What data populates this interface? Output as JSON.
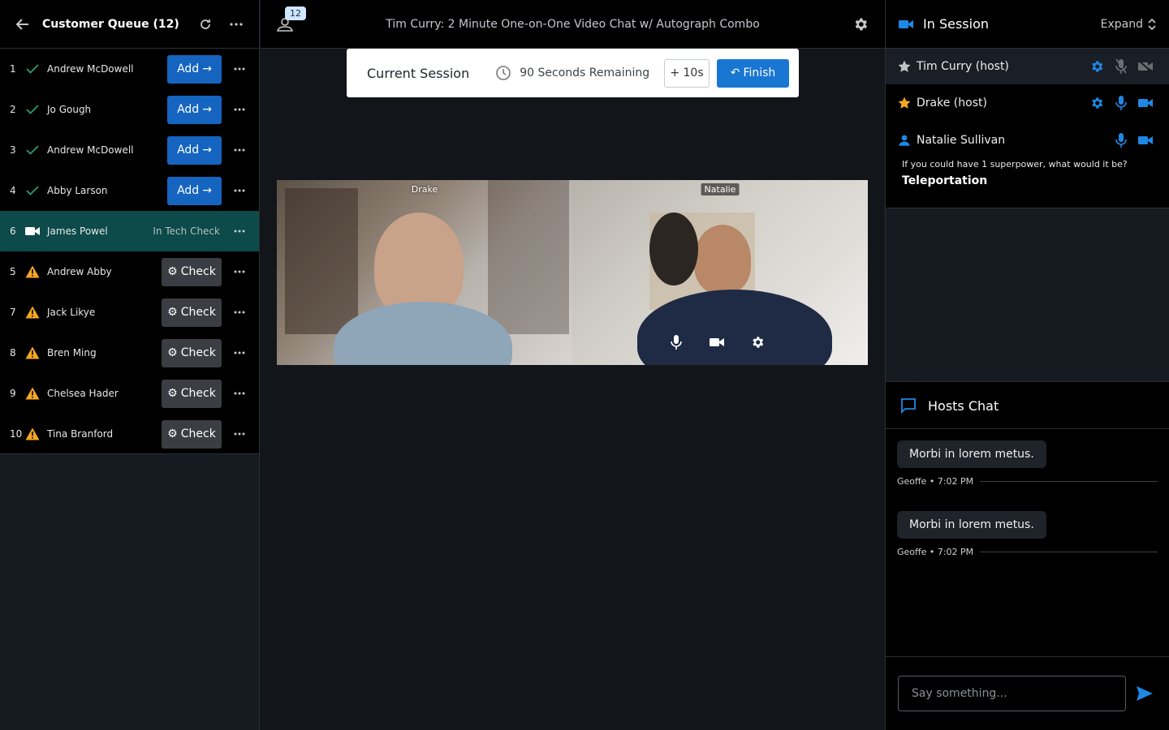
{
  "queue": {
    "title": "Customer Queue (12)",
    "rows": [
      {
        "num": "1",
        "name": "Andrew McDowell",
        "status": "ready",
        "action": "Add"
      },
      {
        "num": "2",
        "name": "Jo Gough",
        "status": "ready",
        "action": "Add"
      },
      {
        "num": "3",
        "name": "Andrew McDowell",
        "status": "ready",
        "action": "Add"
      },
      {
        "num": "4",
        "name": "Abby Larson",
        "status": "ready",
        "action": "Add"
      },
      {
        "num": "6",
        "name": "James Powel",
        "status": "in-tech-check",
        "state_text": "In Tech Check"
      },
      {
        "num": "5",
        "name": "Andrew Abby",
        "status": "warning",
        "action": "Check"
      },
      {
        "num": "7",
        "name": "Jack Likye",
        "status": "warning",
        "action": "Check"
      },
      {
        "num": "8",
        "name": "Bren Ming",
        "status": "warning",
        "action": "Check"
      },
      {
        "num": "9",
        "name": "Chelsea Hader",
        "status": "warning",
        "action": "Check"
      },
      {
        "num": "10",
        "name": "Tina Branford",
        "status": "warning",
        "action": "Check"
      }
    ]
  },
  "topbar": {
    "participant_count": "12",
    "event_title": "Tim Curry: 2 Minute One-on-One Video Chat w/ Autograph Combo"
  },
  "session": {
    "label": "Current Session",
    "time_remaining": "90 Seconds Remaining",
    "add_time_label": "+ 10s",
    "finish_label": "Finish"
  },
  "videos": [
    {
      "name": "Drake"
    },
    {
      "name": "Natalie"
    }
  ],
  "in_session": {
    "title": "In Session",
    "expand_label": "Expand",
    "members": [
      {
        "name": "Tim Curry (host)",
        "role": "host",
        "mic": "muted",
        "camera": "off"
      },
      {
        "name": "Drake (host)",
        "role": "host",
        "mic": "on",
        "camera": "on"
      },
      {
        "name": "Natalie Sullivan",
        "role": "customer",
        "mic": "on",
        "camera": "on"
      }
    ],
    "question": "If you could have 1 superpower, what would it be?",
    "answer": "Teleportation"
  },
  "chat": {
    "title": "Hosts Chat",
    "messages": [
      {
        "text": "Morbi in lorem metus.",
        "meta": "Geoffe • 7:02 PM"
      },
      {
        "text": "Morbi in lorem metus.",
        "meta": "Geoffe • 7:02 PM"
      }
    ],
    "placeholder": "Say something..."
  },
  "colors": {
    "accent": "#1976d2",
    "add_button": "#1565c0",
    "active_row": "#0d4a4a",
    "warning": "#f5a623",
    "ready_check": "#2e9e6a"
  }
}
